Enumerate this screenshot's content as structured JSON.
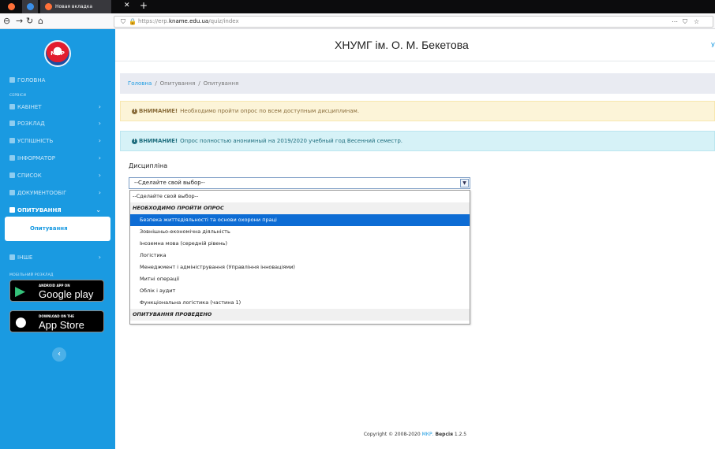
{
  "browser": {
    "tab_title": "Новая вкладка",
    "url_prefix": "https://erp.",
    "url_domain": "kname.edu.ua",
    "url_path": "/quiz/index"
  },
  "sidebar": {
    "logo_text": "МКР",
    "top_items": [
      {
        "label": "ГОЛОВНА"
      }
    ],
    "services_label": "СЕРВІСИ",
    "items": [
      {
        "label": "КАБІНЕТ"
      },
      {
        "label": "РОЗКЛАД"
      },
      {
        "label": "УСПІШНІСТЬ"
      },
      {
        "label": "ІНФОРМАТОР"
      },
      {
        "label": "СПИСОК"
      },
      {
        "label": "ДОКУМЕНТООБІГ"
      },
      {
        "label": "ОПИТУВАННЯ"
      }
    ],
    "submenu": {
      "label": "Опитування"
    },
    "other": {
      "label": "ІНШЕ"
    },
    "mobile_label": "МОБІЛЬНИЙ РОЗКЛАД",
    "google_play": {
      "small": "ANDROID APP ON",
      "big": "Google play"
    },
    "app_store": {
      "small": "DOWNLOAD ON THE",
      "big": "App Store"
    }
  },
  "header": {
    "title": "ХНУМГ ім. О. М. Бекетова",
    "right": "У"
  },
  "breadcrumb": [
    "Головна",
    "Опитування",
    "Опитування"
  ],
  "alerts": {
    "warning": {
      "strong": "ВНИМАНИЕ!",
      "text": "Необходимо пройти опрос по всем доступным дисциплинам."
    },
    "info": {
      "strong": "ВНИМАНИЕ!",
      "text": "Опрос полностью анонимный на 2019/2020 учебный год Весенний семестр."
    }
  },
  "form": {
    "label": "Дисципліна",
    "select_value": "--Сделайте свой выбор--"
  },
  "dropdown": {
    "placeholder": "--Сделайте свой выбор--",
    "group1": "НЕОБХОДИМО ПРОЙТИ ОПРОС",
    "options": [
      "Безпека життєдіяльності та основи охорони праці",
      "Зовнішньо-економічна діяльність",
      "Іноземна мова (середній рівень)",
      "Логістика",
      "Менеджмент і адміністрування (Управління інноваціями)",
      "Митні операції",
      "Облік і аудит",
      "Функціональна логістика (частина 1)"
    ],
    "group2": "ОПИТУВАННЯ ПРОВЕДЕНО"
  },
  "footer": {
    "copyright": "Copyright © 2008-2020",
    "brand": "МКР.",
    "version_label": "Версія",
    "version": "1.2.5"
  }
}
